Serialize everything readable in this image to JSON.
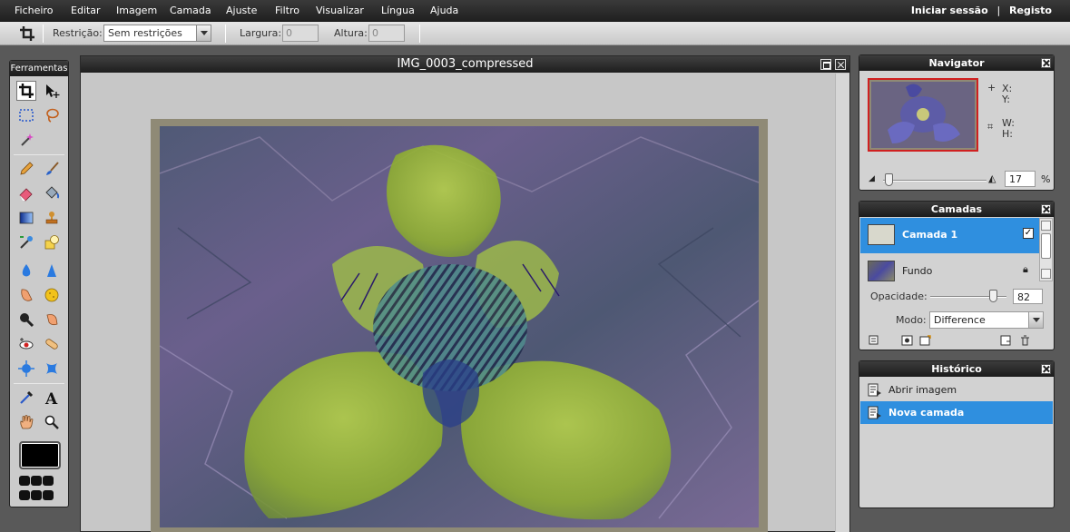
{
  "menu": {
    "items": [
      "Ficheiro",
      "Editar",
      "Imagem",
      "Camada",
      "Ajuste",
      "Filtro",
      "Visualizar",
      "Língua",
      "Ajuda"
    ],
    "login": "Iniciar sessão",
    "separator": "|",
    "register": "Registo"
  },
  "options": {
    "restriction_label": "Restrição:",
    "restriction_value": "Sem restrições",
    "width_label": "Largura:",
    "width_value": "0",
    "height_label": "Altura:",
    "height_value": "0"
  },
  "tools": {
    "title": "Ferramentas",
    "icons": [
      "crop-icon",
      "move-icon",
      "marquee-icon",
      "lasso-icon",
      "magic-wand-icon",
      "pencil-icon",
      "brush-icon",
      "eraser-icon",
      "paint-bucket-icon",
      "gradient-icon",
      "clone-stamp-icon",
      "color-replace-icon",
      "shape-icon",
      "blur-icon",
      "sharpen-icon",
      "smudge-icon",
      "sponge-icon",
      "burn-icon",
      "dodge-icon",
      "red-eye-icon",
      "spot-heal-icon",
      "bloat-icon",
      "pinch-icon",
      "color-picker-icon",
      "type-icon",
      "hand-icon",
      "zoom-icon"
    ],
    "foreground_color": "#000000"
  },
  "document": {
    "title": "IMG_0003_compressed"
  },
  "navigator": {
    "title": "Navigator",
    "x_label": "X:",
    "y_label": "Y:",
    "w_label": "W:",
    "h_label": "H:",
    "zoom_value": "17",
    "zoom_unit": "%",
    "zoom_level_pct": 17
  },
  "layers": {
    "title": "Camadas",
    "items": [
      {
        "name": "Camada 1",
        "selected": true,
        "visible": true
      },
      {
        "name": "Fundo",
        "selected": false,
        "locked": true
      }
    ],
    "opacity_label": "Opacidade:",
    "opacity_value": "82",
    "mode_label": "Modo:",
    "mode_value": "Difference"
  },
  "history": {
    "title": "Histórico",
    "items": [
      {
        "label": "Abrir imagem",
        "selected": false
      },
      {
        "label": "Nova camada",
        "selected": true
      }
    ]
  },
  "colors": {
    "selection": "#2f8fdf",
    "titlebar": "#1f1f1f",
    "panel": "#d2d2d2"
  }
}
